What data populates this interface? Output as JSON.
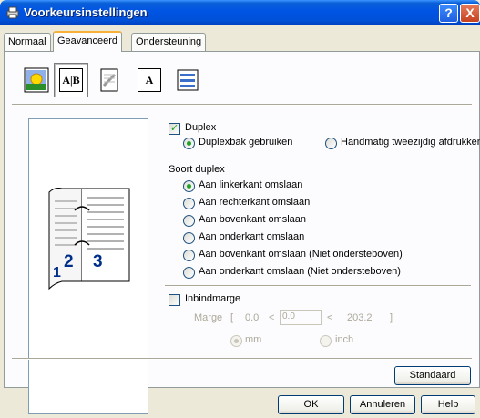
{
  "window": {
    "title": "Voorkeursinstellingen",
    "help_glyph": "?",
    "close_glyph": "X"
  },
  "tabs": [
    {
      "label": "Normaal"
    },
    {
      "label": "Geavanceerd"
    },
    {
      "label": "Ondersteuning"
    }
  ],
  "toolbar": {
    "icons": [
      {
        "name": "quality-icon",
        "active": false
      },
      {
        "name": "duplex-icon",
        "glyph": "A|B",
        "active": true
      },
      {
        "name": "watermark-icon",
        "active": false
      },
      {
        "name": "page-setting-icon",
        "glyph": "A",
        "active": false
      },
      {
        "name": "device-options-icon",
        "active": false
      }
    ]
  },
  "preview": {
    "left_number": "2",
    "right_number": "3",
    "corner_number": "1"
  },
  "duplex": {
    "label": "Duplex",
    "checked": true,
    "options": [
      {
        "label": "Duplexbak gebruiken",
        "checked": true
      },
      {
        "label": "Handmatig tweezijdig afdrukken",
        "checked": false
      }
    ]
  },
  "duplex_type": {
    "heading": "Soort duplex",
    "options": [
      {
        "label": "Aan linkerkant omslaan",
        "checked": true
      },
      {
        "label": "Aan rechterkant omslaan",
        "checked": false
      },
      {
        "label": "Aan bovenkant omslaan",
        "checked": false
      },
      {
        "label": "Aan onderkant omslaan",
        "checked": false
      },
      {
        "label": "Aan bovenkant omslaan (Niet ondersteboven)",
        "checked": false
      },
      {
        "label": "Aan onderkant omslaan (Niet ondersteboven)",
        "checked": false
      }
    ]
  },
  "binding": {
    "label": "Inbindmarge",
    "checked": false,
    "margin_label": "Marge",
    "bracket_open": "[",
    "bracket_close": "]",
    "min": "0.0",
    "lt1": "<",
    "value": "0.0",
    "lt2": "<",
    "max": "203.2",
    "units": [
      {
        "label": "mm",
        "checked": true
      },
      {
        "label": "inch",
        "checked": false
      }
    ]
  },
  "buttons": {
    "default": "Standaard",
    "ok": "OK",
    "cancel": "Annuleren",
    "help": "Help"
  }
}
